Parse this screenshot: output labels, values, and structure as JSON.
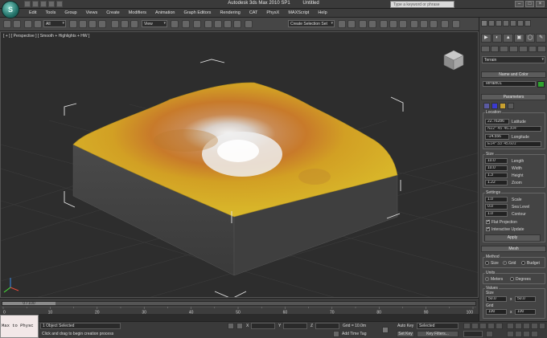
{
  "app": {
    "logo_glyph": "S",
    "title": "Autodesk 3ds Max  2010 SP1",
    "doc_title": "Untitled",
    "search_placeholder": "Type a keyword or phrase",
    "win_minimize": "–",
    "win_maximize": "□",
    "win_close": "×"
  },
  "menu": [
    "Edit",
    "Tools",
    "Group",
    "Views",
    "Create",
    "Modifiers",
    "Animation",
    "Graph Editors",
    "Rendering",
    "CAT",
    "PhysX",
    "MAXScript",
    "Help"
  ],
  "toolbar": {
    "selection_filter": "All",
    "ref_coord": "View",
    "named_selection": "Create Selection Set"
  },
  "viewport": {
    "label": "[ + ] [ Perspective ] [ Smooth + Highlights + HW ]"
  },
  "panel": {
    "tabs": [
      "▶",
      "◐",
      "▲",
      "▣",
      "◯",
      "✎"
    ],
    "category": "Terrain",
    "name_color_rollout": "Name and Color",
    "object_name": "Terrain01",
    "parameters_rollout": "Parameters",
    "location_group": "Location",
    "latitude_value": "22.76286",
    "latitude_label": "Latitude",
    "latitude_dms": "N22° 45' 46.304\"",
    "longitude_value": "-14.556",
    "longitude_label": "Longitude",
    "longitude_dms": "E14° 33' 45.601\"",
    "size_group": "Size",
    "length_value": "10.0",
    "length_label": "Length",
    "width_value": "10.0",
    "width_label": "Width",
    "height_value": "1.3",
    "height_label": "Height",
    "zoom_value": "1.22",
    "zoom_label": "Zoom",
    "settings_group": "Settings",
    "scale_value": "1.0",
    "scale_label": "Scale",
    "sealevel_value": "0.0",
    "sealevel_label": "Sea Level",
    "contour_value": "1.0",
    "contour_label": "Contour",
    "flat_projection": "Flat Projection",
    "interactive_update": "Interactive Update",
    "apply": "Apply",
    "mesh_rollout": "Mesh",
    "method_group": "Method",
    "method_size": "Size",
    "method_grid": "Grid",
    "method_budget": "Budget",
    "units_group": "Units",
    "units_meters": "Meters",
    "units_degrees": "Degrees",
    "values_group": "Values",
    "values_size": "Size",
    "size_a": "50.0",
    "size_b": "50.0",
    "values_grid": "Grid",
    "grid_a": "100",
    "grid_b": "100",
    "x_sep": "x",
    "checkmark": "✔"
  },
  "timeline": {
    "frame": "0 / 100",
    "ticks": [
      "0",
      "10",
      "20",
      "30",
      "40",
      "50",
      "60",
      "70",
      "80",
      "90",
      "100"
    ]
  },
  "status": {
    "maxscript": "Max to Physc",
    "objects_selected": "1 Object Selected",
    "prompt": "Click and drag to begin creation process",
    "x_label": "X",
    "y_label": "Y",
    "z_label": "Z",
    "grid": "Grid = 10.0m",
    "auto_key": "Auto Key",
    "selected": "Selected",
    "set_key": "Set Key",
    "key_filters": "Key Filters...",
    "add_time_tag": "Add Time Tag"
  }
}
